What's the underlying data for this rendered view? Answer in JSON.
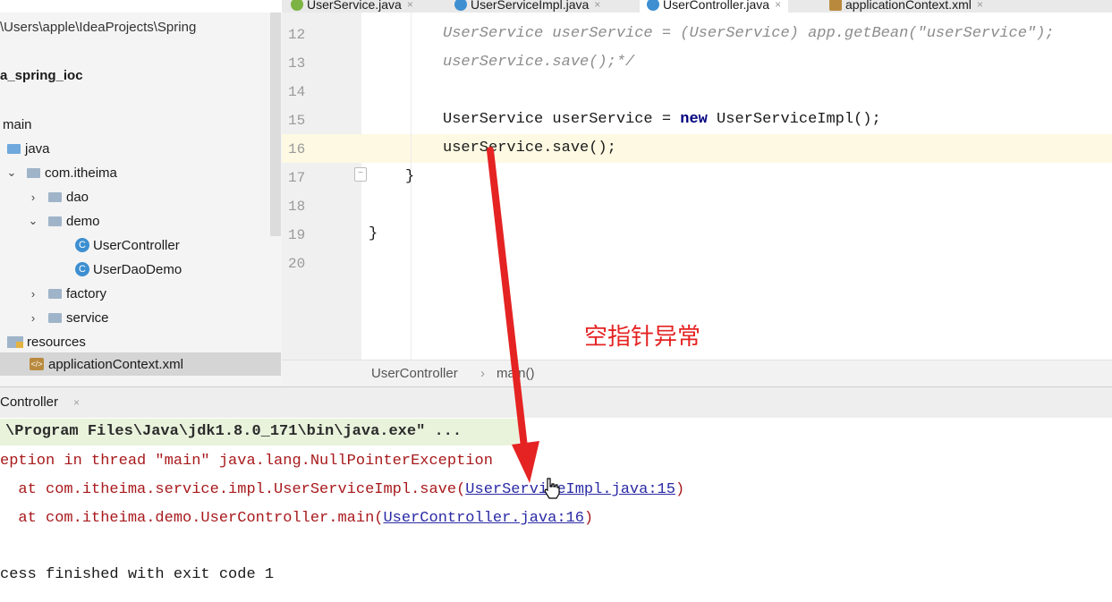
{
  "tabs": [
    {
      "label": "UserService.java",
      "icon": "interface-icon"
    },
    {
      "label": "UserServiceImpl.java",
      "icon": "class-icon"
    },
    {
      "label": "UserController.java",
      "icon": "class-icon",
      "active": true
    },
    {
      "label": "applicationContext.xml",
      "icon": "xml-icon"
    }
  ],
  "project": {
    "path": "\\Users\\apple\\IdeaProjects\\Spring",
    "module": "a_spring_ioc",
    "tree": [
      {
        "label": "main",
        "arrow": "",
        "icon": "none"
      },
      {
        "label": "java",
        "arrow": "",
        "icon": "folder-blue"
      },
      {
        "label": "com.itheima",
        "arrow": "⌄",
        "icon": "folder"
      },
      {
        "label": "dao",
        "arrow": "›",
        "icon": "folder"
      },
      {
        "label": "demo",
        "arrow": "⌄",
        "icon": "folder"
      },
      {
        "label": "UserController",
        "arrow": "",
        "icon": "class"
      },
      {
        "label": "UserDaoDemo",
        "arrow": "",
        "icon": "class"
      },
      {
        "label": "factory",
        "arrow": "›",
        "icon": "folder"
      },
      {
        "label": "service",
        "arrow": "›",
        "icon": "folder"
      },
      {
        "label": "resources",
        "arrow": "",
        "icon": "resources"
      },
      {
        "label": "applicationContext.xml",
        "arrow": "",
        "icon": "xml",
        "selected": true
      }
    ]
  },
  "editor": {
    "lines": [
      {
        "num": "12",
        "text": "UserService userService = (UserService) app.getBean(\"userService\");",
        "style": "comment"
      },
      {
        "num": "13",
        "text": "userService.save();*/",
        "style": "comment"
      },
      {
        "num": "14",
        "text": "",
        "style": "plain"
      },
      {
        "num": "15",
        "pre": "UserService userService = ",
        "kw": "new",
        "post": " UserServiceImpl();",
        "style": "kw-line"
      },
      {
        "num": "16",
        "text": "userService.save();",
        "style": "plain"
      },
      {
        "num": "17",
        "text": "}",
        "style": "plain"
      },
      {
        "num": "18",
        "text": "",
        "style": "plain"
      },
      {
        "num": "19",
        "text": "}",
        "style": "plain"
      },
      {
        "num": "20",
        "text": "",
        "style": "plain"
      }
    ],
    "breadcrumb": [
      "UserController",
      "main()"
    ]
  },
  "run": {
    "tab_label": "Controller",
    "console": {
      "command": "\\Program Files\\Java\\jdk1.8.0_171\\bin\\java.exe\" ...",
      "exception": "eption in thread \"main\" java.lang.NullPointerException",
      "trace": [
        {
          "prefix": "  at com.itheima.service.impl.UserServiceImpl.save(",
          "link": "UserServiceImpl.java:15",
          "suffix": ")"
        },
        {
          "prefix": "  at com.itheima.demo.UserController.main(",
          "link": "UserController.java:16",
          "suffix": ")"
        }
      ],
      "finish": "cess finished with exit code 1"
    }
  },
  "annotation": {
    "text": "空指针异常",
    "color": "#e52323"
  },
  "colors": {
    "error": "#a8191c",
    "link": "#2a2aa5",
    "keyword": "#000080",
    "comment": "#8c8c8c"
  }
}
